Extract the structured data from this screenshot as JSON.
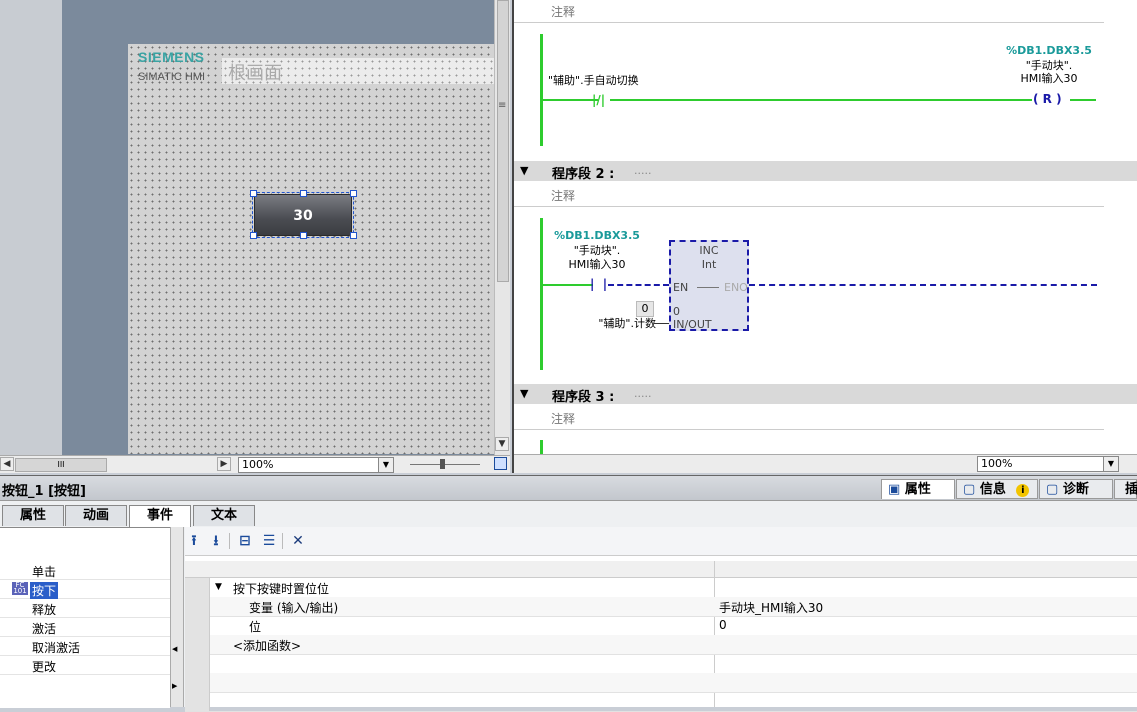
{
  "hmi": {
    "logo_siemens": "SIEMENS",
    "logo_simatic": "SIMATIC HMI",
    "screen_title": "根画面",
    "button_text": "30",
    "zoom": "100%"
  },
  "ladder": {
    "comment_label": "注释",
    "zoom": "100%",
    "segment2": {
      "title": "程序段 2 :",
      "dots": "....."
    },
    "segment3": {
      "title": "程序段 3 :",
      "dots": "....."
    },
    "network1": {
      "contact_tag": "\"辅助\".手自动切换",
      "coil_addr": "%DB1.DBX3.5",
      "coil_tag_line1": "\"手动块\".",
      "coil_tag_line2": "HMI输入30",
      "coil_symbol": "( R )"
    },
    "network2": {
      "contact_addr": "%DB1.DBX3.5",
      "contact_tag_line1": "\"手动块\".",
      "contact_tag_line2": "HMI输入30",
      "box_name": "INC",
      "box_type": "Int",
      "en": "EN",
      "eno": "ENO",
      "inout_label": "IN/OUT",
      "inout_value": "0",
      "operand_value": "0",
      "operand_tag": "\"辅助\".计数"
    }
  },
  "inspector": {
    "title": "按钮_1 [按钮]",
    "right_tabs": [
      {
        "label": "属性",
        "icon": "properties-icon"
      },
      {
        "label": "信息",
        "icon": "info-icon"
      },
      {
        "label": "诊断",
        "icon": "diagnostics-icon"
      },
      {
        "label": "插"
      }
    ],
    "tabs": [
      "属性",
      "动画",
      "事件",
      "文本"
    ],
    "active_tab": "事件",
    "events": [
      "单击",
      "按下",
      "释放",
      "激活",
      "取消激活",
      "更改"
    ],
    "selected_event": "按下",
    "function_rows": [
      {
        "name": "按下按键时置位位",
        "value": ""
      },
      {
        "name": "变量 (输入/输出)",
        "value": "手动块_HMI输入30"
      },
      {
        "name": "位",
        "value": "0"
      },
      {
        "name": "<添加函数>",
        "value": ""
      }
    ]
  },
  "colors": {
    "rail_green": "#2ecc2e",
    "wire_blue": "#1a1aa8",
    "selection_blue": "#2a5ec9",
    "addr_teal": "#1a9a9a"
  }
}
